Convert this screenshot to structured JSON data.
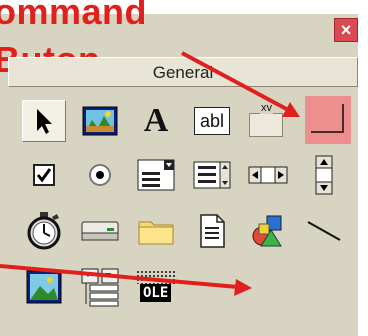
{
  "annotation": {
    "line1": "ommand",
    "line2": "Buton"
  },
  "window": {
    "close_glyph": "×"
  },
  "tab": {
    "label": "General"
  },
  "tools": {
    "label_text": "A",
    "textbox_text": "abl",
    "frame_text": "xv",
    "ole_text": "OLE"
  },
  "colors": {
    "annotation_red": "#e0201c",
    "toolbox_bg": "#d8d4c2",
    "command_button": "#ee8f8f"
  },
  "icons": [
    "pointer-icon",
    "picturebox-icon",
    "label-icon",
    "textbox-icon",
    "frame-icon",
    "commandbutton-icon",
    "checkbox-icon",
    "optionbutton-icon",
    "combobox-icon",
    "listbox-icon",
    "hscrollbar-icon",
    "vscrollbar-icon",
    "timer-icon",
    "drivelistbox-icon",
    "dirlistbox-icon",
    "filelistbox-icon",
    "shape-icon",
    "line-icon",
    "image-icon",
    "data-icon",
    "ole-icon"
  ]
}
